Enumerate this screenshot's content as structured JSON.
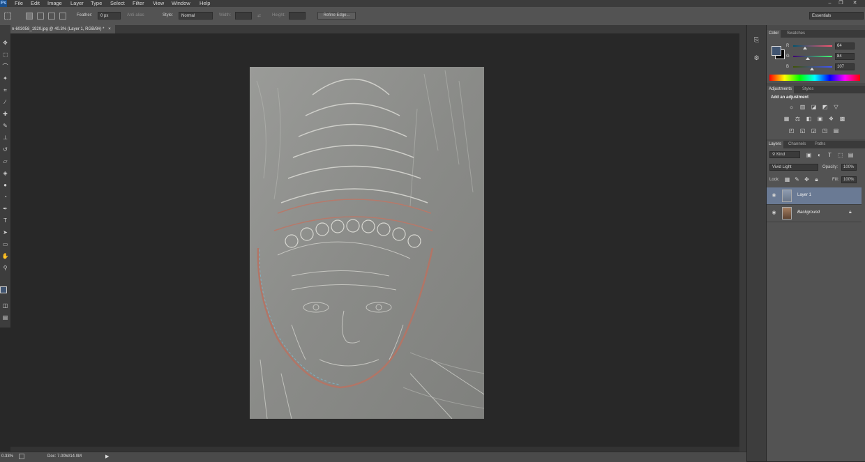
{
  "menubar": {
    "logo": "Ps",
    "items": [
      "File",
      "Edit",
      "Image",
      "Layer",
      "Type",
      "Select",
      "Filter",
      "View",
      "Window",
      "Help"
    ],
    "window_buttons": [
      "–",
      "❐",
      "✕"
    ]
  },
  "options": {
    "feather_label": "Feather:",
    "feather_value": "0 px",
    "antialias_label": "Anti-alias",
    "style_label": "Style:",
    "style_value": "Normal",
    "width_label": "Width:",
    "height_label": "Height:",
    "refine_label": "Refine Edge...",
    "workspace": "Essentials"
  },
  "document": {
    "tab_title": "n-603058_1920.jpg @ 40.3% (Layer 1, RGB/8#) *",
    "tab_close": "×"
  },
  "status": {
    "zoom": "0.33%",
    "doc_info": "Doc: 7.00M/14.0M",
    "arrow": "▶"
  },
  "color_panel": {
    "tabs": [
      "Color",
      "Swatches"
    ],
    "channels": [
      {
        "name": "R",
        "value": "64",
        "fraction": 0.25
      },
      {
        "name": "G",
        "value": "84",
        "fraction": 0.33
      },
      {
        "name": "B",
        "value": "107",
        "fraction": 0.42
      }
    ],
    "foreground": "#405470",
    "background": "#000000"
  },
  "adjustments_panel": {
    "tabs": [
      "Adjustments",
      "Styles"
    ],
    "heading": "Add an adjustment"
  },
  "layers_panel": {
    "tabs": [
      "Layers",
      "Channels",
      "Paths"
    ],
    "kind_label": "Kind",
    "blend_mode": "Vivid Light",
    "opacity_label": "Opacity:",
    "opacity_value": "100%",
    "lock_label": "Lock:",
    "fill_label": "Fill:",
    "fill_value": "100%",
    "layers": [
      {
        "name": "Layer 1",
        "selected": true
      },
      {
        "name": "Background",
        "selected": false,
        "locked": true
      }
    ]
  }
}
